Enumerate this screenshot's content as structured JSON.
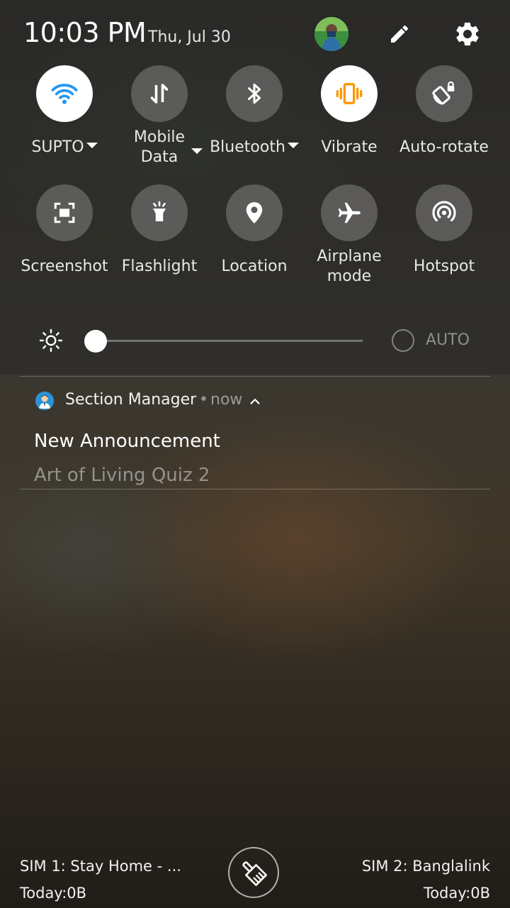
{
  "header": {
    "time": "10:03 PM",
    "date": "Thu, Jul 30",
    "avatar_icon": "user-avatar",
    "edit_icon": "pencil-icon",
    "settings_icon": "gear-icon"
  },
  "tiles": [
    {
      "label": "SUPTO",
      "icon": "wifi-icon",
      "active": true,
      "dropdown": true
    },
    {
      "label_line1": "Mobile",
      "label_line2": "Data",
      "icon": "mobile-data-icon",
      "active": false,
      "dropdown": true
    },
    {
      "label": "Bluetooth",
      "icon": "bluetooth-icon",
      "active": false,
      "dropdown": true
    },
    {
      "label": "Vibrate",
      "icon": "vibrate-icon",
      "active": true,
      "dropdown": false
    },
    {
      "label": "Auto-rotate",
      "icon": "rotate-lock-icon",
      "active": false,
      "dropdown": false
    },
    {
      "label": "Screenshot",
      "icon": "screenshot-icon",
      "active": false
    },
    {
      "label": "Flashlight",
      "icon": "flashlight-icon",
      "active": false
    },
    {
      "label": "Location",
      "icon": "location-pin-icon",
      "active": false
    },
    {
      "label_line1": "Airplane",
      "label_line2": "mode",
      "icon": "airplane-icon",
      "active": false
    },
    {
      "label": "Hotspot",
      "icon": "hotspot-icon",
      "active": false
    }
  ],
  "colors": {
    "wifi_active": "#2196f3",
    "vibrate_active": "#ff9800"
  },
  "brightness": {
    "level": 0.0,
    "auto_label": "AUTO",
    "auto_enabled": false
  },
  "notification": {
    "app_name": "Section Manager",
    "separator": "•",
    "time": "now",
    "title": "New Announcement",
    "text": "Art of Living Quiz 2"
  },
  "footer": {
    "sim1_name": "SIM 1: Stay Home - ...",
    "sim1_usage": "Today:0B",
    "sim2_name": "SIM 2: Banglalink",
    "sim2_usage": "Today:0B",
    "clear_icon": "broom-icon"
  }
}
